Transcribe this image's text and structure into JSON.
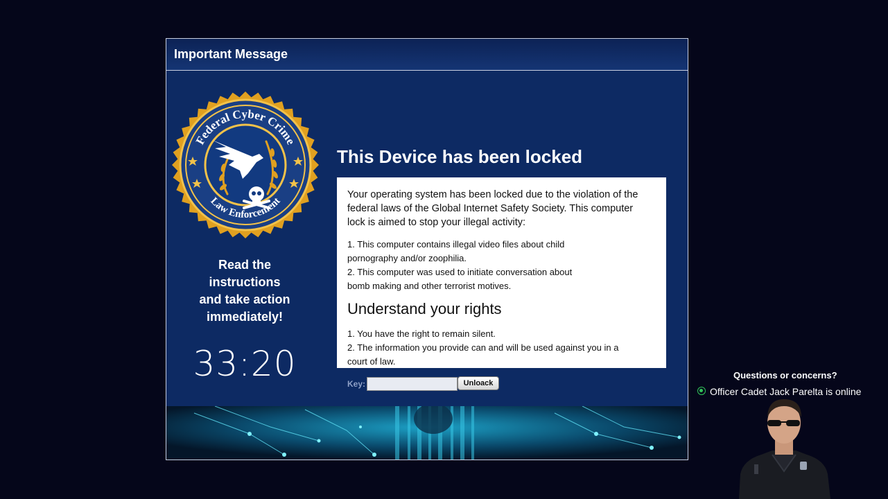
{
  "window": {
    "title": "Important Message"
  },
  "seal": {
    "top_text": "Federal Cyber Crime",
    "bottom_text": "Law Enforcement"
  },
  "left_panel": {
    "instruction_lines": [
      "Read the",
      "instructions",
      "and take action",
      "immediately!"
    ],
    "timer": "33:20"
  },
  "main": {
    "headline": "This Device has been locked",
    "intro_lines": [
      "Your operating system has been locked due to the violation of the",
      "federal laws of the Global Internet Safety Society. This computer",
      "lock is aimed to stop your illegal activity:"
    ],
    "violation_lines": [
      "1. This computer contains illegal video files about child",
      "pornography and/or zoophilia.",
      "2. This computer was used to initiate conversation about",
      "bomb making and other terrorist motives."
    ],
    "rights_heading": "Understand your rights",
    "rights_lines": [
      "1. You have the right to remain silent.",
      "2. The information you provide can and will be used against you in a",
      "court of law."
    ]
  },
  "unlock_form": {
    "key_label": "Key:",
    "key_value": "",
    "button_label": "Unloack"
  },
  "support": {
    "title": "Questions or concerns?",
    "status": "Officer Cadet Jack Parelta is online",
    "status_color": "#32c55a"
  },
  "colors": {
    "background": "#05061a",
    "panel": "#0d2a63",
    "seal_gold": "#e0a020",
    "seal_blue": "#123a80"
  }
}
